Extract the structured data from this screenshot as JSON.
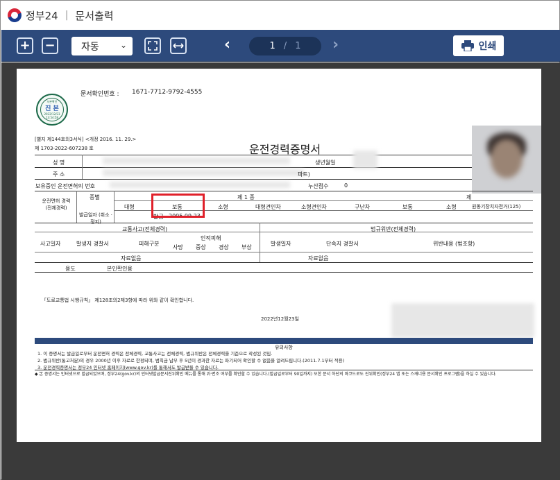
{
  "titlebar": {
    "brand": "정부24",
    "separator": "|",
    "title": "문서출력"
  },
  "toolbar": {
    "zoom_in": "+",
    "zoom_out": "−",
    "zoom_mode": "자동",
    "page_current": "1",
    "page_separator": "/",
    "page_total": "1",
    "print_label": "인쇄"
  },
  "doc": {
    "doc_confirm_label": "문서확인번호 :",
    "doc_confirm_number": "1671-7712-9792-4555",
    "stamp": {
      "ring": "사본확인",
      "date": "2022/12/23",
      "time": "13:54:58",
      "kst": "KST",
      "main": "진 본",
      "issuer": "정부24"
    },
    "form_ref": "[별지 제144호의3서식] <개정 2016. 11. 29.>",
    "doc_no": "제 1703-2022-607238 호",
    "title": "운전경력증명서",
    "row_name_label": "성      명",
    "row_birth_label": "생년월일",
    "row_addr_label": "주      소",
    "row_addr_tail": "파트)",
    "row_license_label": "보유중인 운전면허의 번호",
    "row_penalty_label": "누산점수",
    "row_penalty_value": "0",
    "license_label": "운전면허 경력 (전체경력)",
    "kind_label": "종별",
    "issue_date_label": "발급일자 (취소 · 정지)",
    "class1_label": "제 1 종",
    "class2_label": "제",
    "col_large": "대형",
    "col_normal": "보통",
    "col_small": "소형",
    "col_large_tow": "대형견인차",
    "col_small_tow": "소형견인차",
    "col_wrecker": "구난차",
    "col_normal2": "보통",
    "col_small2": "소형",
    "col_motor": "원동기장치자전거(125)",
    "issue_tag": "발급",
    "issue_date": "2005.09.23",
    "accident_head": "교통사고(전체경력)",
    "violation_head": "법규위반(전체경력)",
    "acc_date": "사고일자",
    "acc_place": "발생지 경찰서",
    "acc_type": "피해구분",
    "acc_casualty": "인적피해",
    "acc_death": "사망",
    "acc_serious": "중상",
    "acc_minor": "경상",
    "acc_report": "부상",
    "vio_date": "발생일자",
    "vio_police": "단속지 경찰서",
    "vio_content": "위반내용 (법조항)",
    "no_data_1": "자료없음",
    "no_data_2": "자료없음",
    "purpose_label": "용도",
    "purpose_value": "본인확인용",
    "law_text": "「도로교통법 시행규칙」 제128조의2제3항에 따라 위와 같이 확인합니다.",
    "issue_day": "2022년12월23일",
    "notice_head": "유의사항",
    "notices": [
      "1. 이 증명서는 발급일로부터 운전면허 경력은 전체경력, 교통사고는 전체경력, 법규위반은 전체경력을 기준으로 작성된 것임.",
      "2. 법규위반(통고처분)의 경우 2000년 이후 자료로 한정되며, 범칙금 납부 후 5년이 경과한 자료는 파기되어 확인할 수 없음을 알려드립니다.(2011.7.1부터 적용)",
      "3. 운전경력증명서는 정부24 인터넷 홈페이지(www.gov.kr)를 통해서도 발급받을 수 있습니다."
    ],
    "footer_note": "◆ 본 증명서는 인터넷으로 발급되었으며, 정부24(gov.kr)의 인터넷발급문서진위확인 메뉴를 통해 위·변조 여부를 확인할 수 있습니다.(발급일로부터 90일까지) 또한 문서 하단의 바코드로도 진위확인(정부24 앱 또는 스캐너용 문서확인 프로그램)을 하실 수 있습니다."
  }
}
